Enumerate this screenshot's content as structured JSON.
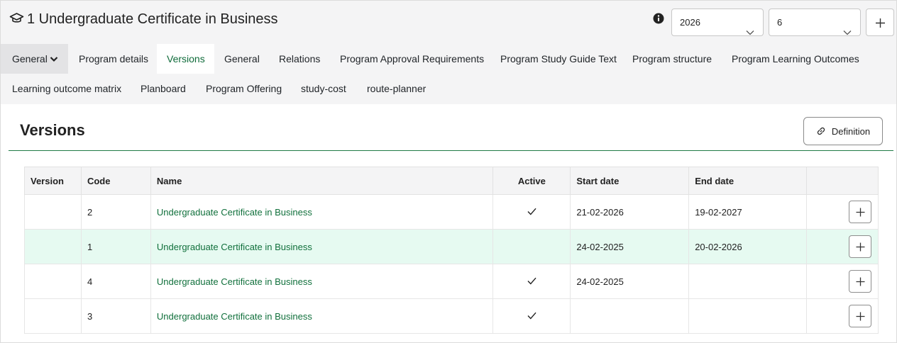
{
  "header": {
    "title": "1 Undergraduate Certificate in Business",
    "year_select": "2026",
    "number_select": "6"
  },
  "tabs": [
    {
      "label": "General",
      "dropdown": true
    },
    {
      "label": "Program details"
    },
    {
      "label": "Versions",
      "active": true
    },
    {
      "label": "General"
    },
    {
      "label": "Relations"
    },
    {
      "label": "Program Approval Requirements"
    },
    {
      "label": "Program Study Guide Text"
    },
    {
      "label": "Program structure"
    },
    {
      "label": "Program Learning Outcomes"
    },
    {
      "label": "Learning outcome matrix"
    },
    {
      "label": "Planboard"
    },
    {
      "label": "Program Offering"
    },
    {
      "label": "study-cost"
    },
    {
      "label": "route-planner"
    }
  ],
  "section": {
    "title": "Versions",
    "definition_label": "Definition"
  },
  "table": {
    "columns": [
      "Version",
      "Code",
      "Name",
      "Active",
      "Start date",
      "End date",
      ""
    ],
    "rows": [
      {
        "version": "",
        "code": "2",
        "name": "Undergraduate Certificate in Business",
        "active": true,
        "start": "21-02-2026",
        "end": "19-02-2027"
      },
      {
        "version": "",
        "code": "1",
        "name": "Undergraduate Certificate in Business",
        "active": false,
        "start": "24-02-2025",
        "end": "20-02-2026",
        "highlighted": true
      },
      {
        "version": "",
        "code": "4",
        "name": "Undergraduate Certificate in Business",
        "active": true,
        "start": "24-02-2025",
        "end": ""
      },
      {
        "version": "",
        "code": "3",
        "name": "Undergraduate Certificate in Business",
        "active": true,
        "start": "",
        "end": ""
      }
    ]
  },
  "colors": {
    "accent": "#11703c",
    "highlight_row": "#e6faf1",
    "header_bg": "#f4f4f5"
  }
}
